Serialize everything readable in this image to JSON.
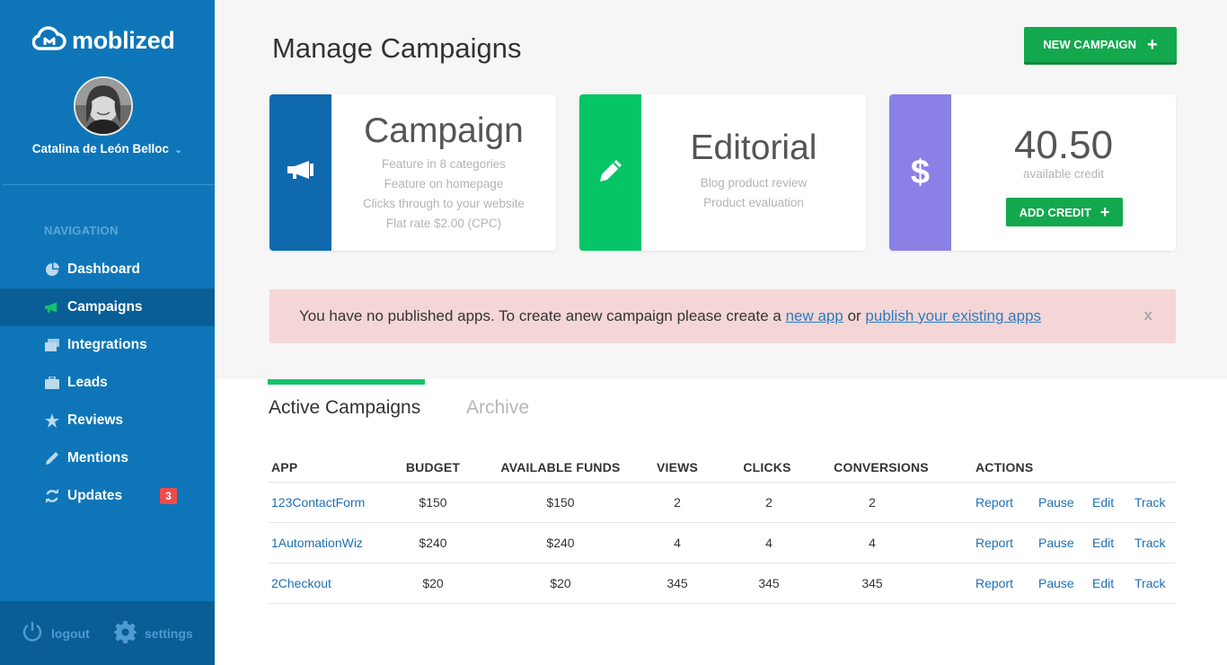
{
  "brand": {
    "name": "moblized"
  },
  "user": {
    "name": "Catalina de León Belloc"
  },
  "nav": {
    "heading": "NAVIGATION",
    "items": [
      {
        "label": "Dashboard",
        "icon": "pie-chart-icon"
      },
      {
        "label": "Campaigns",
        "icon": "megaphone-icon",
        "active": true
      },
      {
        "label": "Integrations",
        "icon": "stack-icon"
      },
      {
        "label": "Leads",
        "icon": "briefcase-icon"
      },
      {
        "label": "Reviews",
        "icon": "star-icon"
      },
      {
        "label": "Mentions",
        "icon": "pencil-icon"
      },
      {
        "label": "Updates",
        "icon": "refresh-icon",
        "badge": "3"
      }
    ]
  },
  "footer": {
    "logout": "logout",
    "settings": "settings"
  },
  "header": {
    "title": "Manage Campaigns",
    "new_campaign": "NEW CAMPAIGN"
  },
  "cards": {
    "campaign": {
      "title": "Campaign",
      "lines": [
        "Feature in 8 categories",
        "Feature on homepage",
        "Clicks through to your website",
        "Flat rate $2.00 (CPC)"
      ],
      "color": "#0e6aad"
    },
    "editorial": {
      "title": "Editorial",
      "lines": [
        "Blog product review",
        "Product evaluation"
      ],
      "color": "#05c566"
    },
    "credit": {
      "amount": "40.50",
      "label": "available credit",
      "button": "ADD CREDIT",
      "color": "#8b80e6"
    }
  },
  "alert": {
    "text_before": "You have no published apps. To create anew campaign please create a ",
    "link1": "new app",
    "text_mid": " or ",
    "link2": "publish your existing apps",
    "close": "x"
  },
  "tabs": {
    "active": "Active Campaigns",
    "archive": "Archive"
  },
  "table": {
    "headers": {
      "app": "APP",
      "budget": "BUDGET",
      "funds": "AVAILABLE FUNDS",
      "views": "VIEWS",
      "clicks": "CLICKS",
      "conversions": "CONVERSIONS",
      "actions": "ACTIONS"
    },
    "actions": {
      "report": "Report",
      "pause": "Pause",
      "edit": "Edit",
      "track": "Track"
    },
    "rows": [
      {
        "app": "123ContactForm",
        "budget": "$150",
        "funds": "$150",
        "views": "2",
        "clicks": "2",
        "conversions": "2"
      },
      {
        "app": "1AutomationWiz",
        "budget": "$240",
        "funds": "$240",
        "views": "4",
        "clicks": "4",
        "conversions": "4"
      },
      {
        "app": "2Checkout",
        "budget": "$20",
        "funds": "$20",
        "views": "345",
        "clicks": "345",
        "conversions": "345"
      }
    ]
  }
}
